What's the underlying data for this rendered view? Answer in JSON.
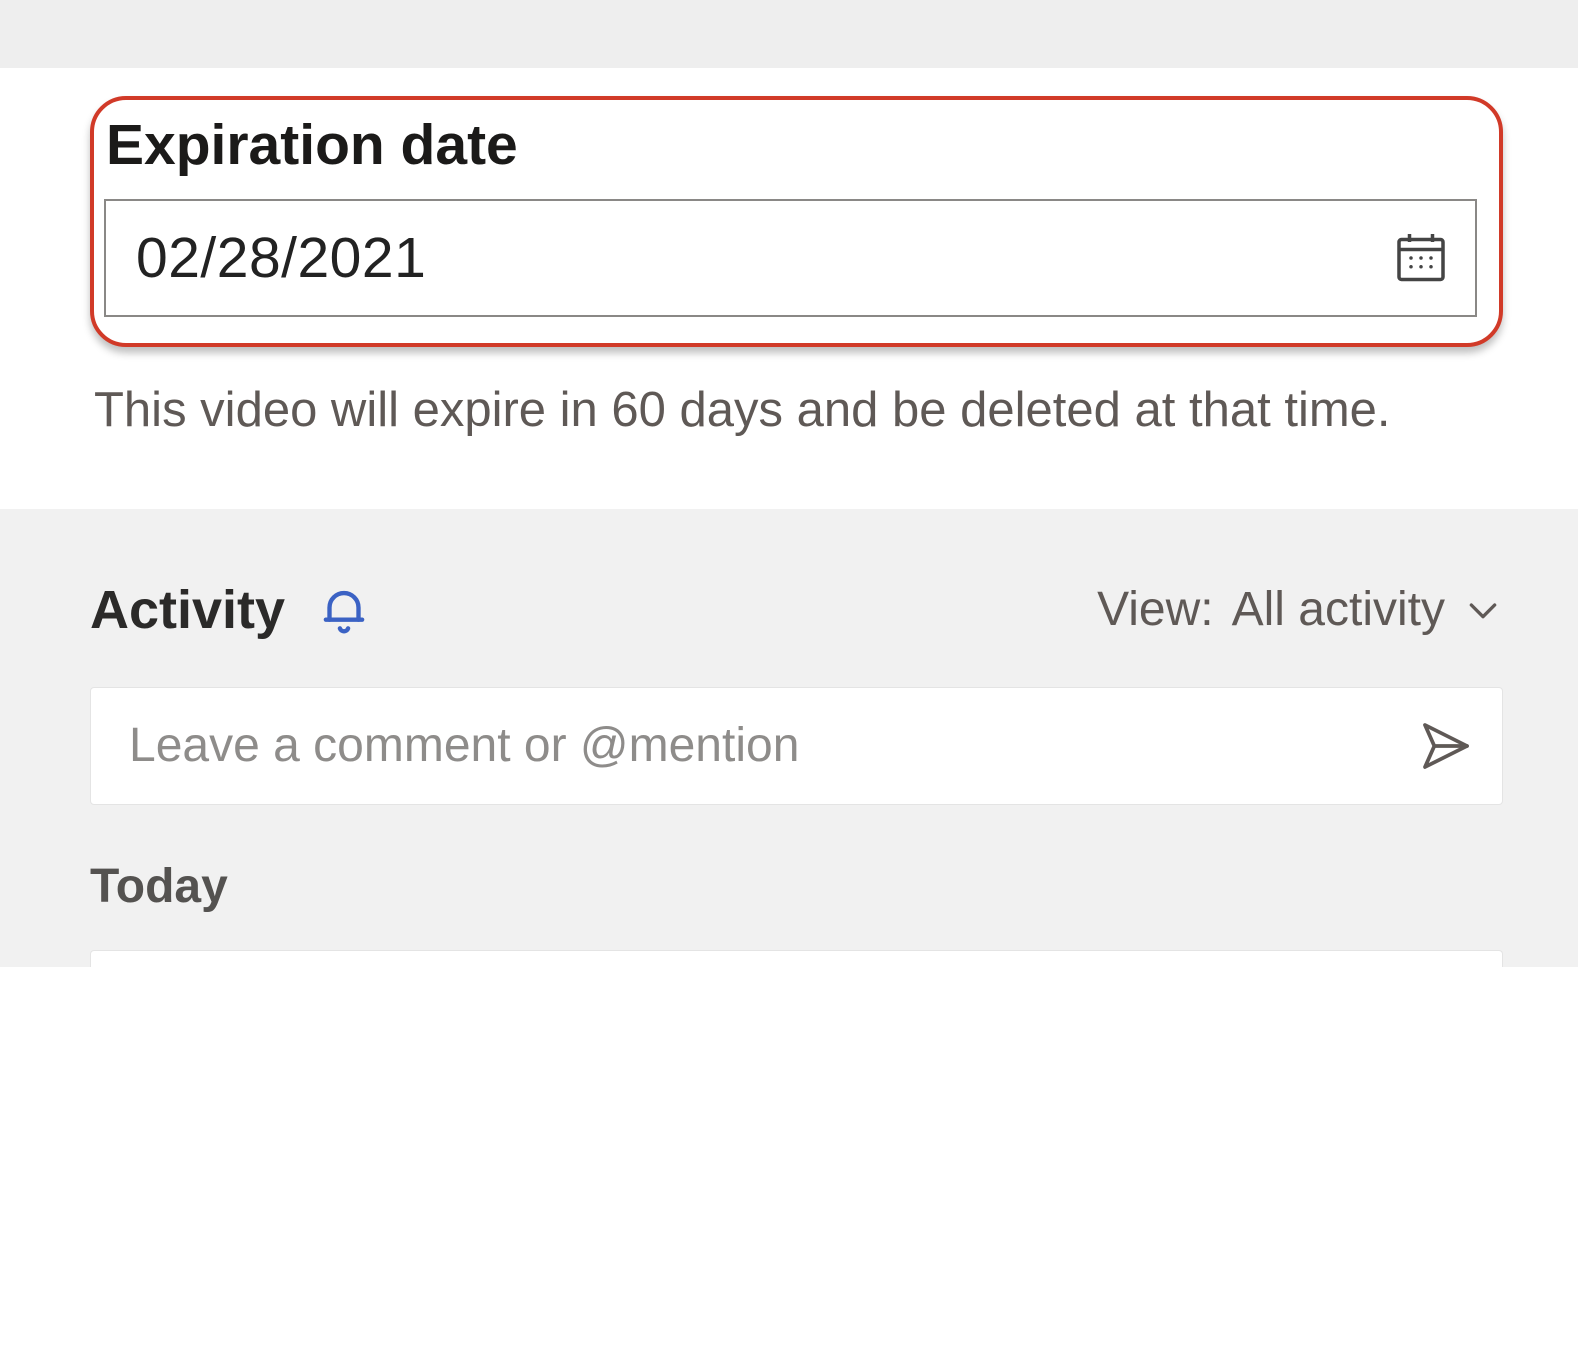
{
  "expiration": {
    "label": "Expiration date",
    "value": "02/28/2021",
    "helper": "This video will expire in 60 days and be deleted at that time."
  },
  "activity": {
    "title": "Activity",
    "filter_prefix": "View:",
    "filter_value": "All activity",
    "comment_placeholder": "Leave a comment or @mention",
    "today_label": "Today"
  }
}
